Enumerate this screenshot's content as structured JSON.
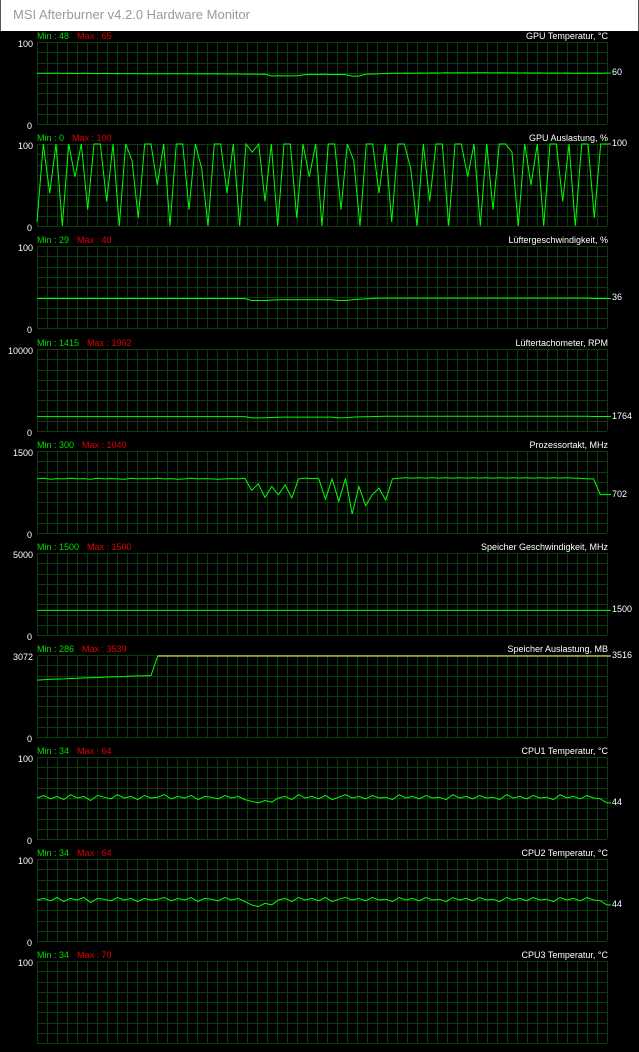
{
  "window": {
    "title": "MSI Afterburner v4.2.0 Hardware Monitor"
  },
  "colors": {
    "grid": "#0b3d0b",
    "trace": "#00ff00",
    "trace_alt": "#ffff66",
    "min_text": "#00dd00",
    "max_text": "#e00000"
  },
  "panels": [
    {
      "title": "GPU Temperatur, °C",
      "min_label": "Min : 48",
      "max_label": "Max : 65",
      "y_max": "100",
      "y_min": "0",
      "current": "60",
      "scale_max": 100,
      "line_color": "#00ff00",
      "series": [
        62,
        62,
        61.8,
        61.9,
        61.7,
        61.8,
        61.6,
        61.8,
        61.6,
        61.5,
        61.7,
        61.5,
        61.6,
        61.4,
        61.5,
        61.3,
        61.5,
        61.4,
        61.3,
        61.4,
        61.2,
        61.3,
        61.2,
        61.3,
        61.1,
        61.2,
        61.1,
        61.2,
        61.0,
        61.1,
        61.0,
        60.8,
        60.9,
        60.7,
        60.8,
        58.5,
        58.8,
        58.7,
        58.6,
        59.0,
        60.3,
        60.5,
        60.5,
        60.6,
        60.3,
        60.5,
        60.2,
        58.2,
        58.5,
        60.6,
        61.0,
        61.3,
        61.5,
        61.8,
        62,
        62.1,
        62.0,
        62.2,
        62.1,
        62.3,
        62.2,
        62.4,
        62.3,
        62.4,
        62.3,
        62.5,
        62.4,
        62.5,
        62.3,
        62.4,
        62.3,
        62.4,
        62.2,
        62.3,
        62.2,
        62.3,
        62.1,
        62.2,
        62.1,
        62.2,
        62.0,
        62.1,
        62.0,
        62.1,
        62.0,
        62.1
      ]
    },
    {
      "title": "GPU Auslastung, %",
      "min_label": "Min : 0",
      "max_label": "Max : 100",
      "y_max": "100",
      "y_min": "0",
      "current": "100",
      "scale_max": 100,
      "line_color": "#00ff00",
      "series": [
        5,
        100,
        40,
        100,
        0,
        100,
        60,
        100,
        20,
        100,
        100,
        30,
        100,
        0,
        100,
        80,
        10,
        100,
        100,
        50,
        100,
        0,
        100,
        100,
        20,
        100,
        70,
        0,
        100,
        100,
        40,
        100,
        0,
        100,
        90,
        100,
        30,
        100,
        0,
        100,
        100,
        10,
        100,
        60,
        100,
        0,
        100,
        100,
        20,
        100,
        80,
        0,
        100,
        100,
        40,
        100,
        5,
        100,
        100,
        70,
        0,
        100,
        30,
        100,
        100,
        0,
        100,
        100,
        60,
        100,
        0,
        100,
        20,
        100,
        100,
        90,
        0,
        100,
        50,
        100,
        0,
        100,
        100,
        30,
        100,
        0,
        100,
        100,
        10,
        100,
        100
      ]
    },
    {
      "title": "Lüftergeschwindigkeit, %",
      "min_label": "Min : 29",
      "max_label": "Max : 40",
      "y_max": "100",
      "y_min": "0",
      "current": "36",
      "scale_max": 100,
      "line_color": "#00ff00",
      "series": [
        36,
        36,
        36,
        36,
        36,
        36,
        36,
        36,
        36,
        36,
        36,
        36,
        36,
        36,
        36,
        36,
        36,
        36,
        36,
        36,
        36,
        36,
        36,
        36,
        36,
        36,
        36,
        36,
        36,
        36,
        36,
        36,
        33.5,
        33.5,
        33.5,
        34,
        34.5,
        34.5,
        34.5,
        34.5,
        34.5,
        34.5,
        34.5,
        34.5,
        34.5,
        33.5,
        33.5,
        34.5,
        35,
        35.5,
        36,
        36.5,
        36.5,
        36.5,
        36.5,
        36.5,
        36.5,
        36.5,
        36.5,
        36.5,
        36.5,
        36.5,
        36.5,
        36.5,
        36.5,
        36.5,
        36.5,
        36.5,
        36.5,
        36.5,
        36.5,
        36.5,
        36.5,
        36.5,
        36.5,
        36.5,
        36.5,
        36.5,
        36.5,
        36.5,
        36.5,
        36.5,
        36.5,
        36,
        36,
        36
      ]
    },
    {
      "title": "Lüftertachometer, RPM",
      "min_label": "Min : 1415",
      "max_label": "Max : 1962",
      "y_max": "10000",
      "y_min": "0",
      "current": "1764",
      "scale_max": 10000,
      "line_color": "#00ff00",
      "series": [
        1760,
        1760,
        1760,
        1760,
        1760,
        1760,
        1760,
        1760,
        1760,
        1760,
        1760,
        1760,
        1760,
        1760,
        1760,
        1760,
        1760,
        1760,
        1760,
        1760,
        1760,
        1760,
        1760,
        1760,
        1760,
        1760,
        1760,
        1760,
        1760,
        1760,
        1760,
        1760,
        1600,
        1600,
        1620,
        1650,
        1680,
        1700,
        1700,
        1700,
        1700,
        1700,
        1700,
        1700,
        1700,
        1600,
        1620,
        1700,
        1720,
        1740,
        1760,
        1780,
        1790,
        1790,
        1790,
        1790,
        1790,
        1790,
        1790,
        1790,
        1790,
        1790,
        1790,
        1790,
        1790,
        1790,
        1790,
        1790,
        1790,
        1790,
        1790,
        1790,
        1790,
        1790,
        1790,
        1790,
        1790,
        1790,
        1790,
        1790,
        1790,
        1790,
        1790,
        1770,
        1764,
        1764
      ]
    },
    {
      "title": "Prozessortakt, MHz",
      "min_label": "Min : 300",
      "max_label": "Max : 1040",
      "y_max": "1500",
      "y_min": "0",
      "current": "702",
      "scale_max": 1500,
      "line_color": "#00ff00",
      "series": [
        990,
        1000,
        985,
        995,
        990,
        1000,
        990,
        995,
        985,
        1000,
        990,
        995,
        990,
        985,
        1000,
        990,
        995,
        990,
        1000,
        990,
        995,
        985,
        990,
        1000,
        990,
        995,
        990,
        985,
        990,
        995,
        990,
        1000,
        780,
        900,
        650,
        850,
        700,
        880,
        640,
        990,
        1005,
        995,
        1000,
        620,
        990,
        580,
        1000,
        350,
        850,
        500,
        700,
        820,
        600,
        990,
        1000,
        1010,
        1005,
        1010,
        1005,
        1010,
        1005,
        1010,
        1005,
        1010,
        1005,
        1010,
        1005,
        1010,
        1005,
        1010,
        1005,
        1010,
        1005,
        1010,
        1005,
        1010,
        1005,
        1010,
        1005,
        1010,
        1005,
        1000,
        990,
        990,
        702,
        702
      ]
    },
    {
      "title": "Speicher Geschwindigkeit, MHz",
      "min_label": "Min : 1500",
      "max_label": "Max : 1500",
      "y_max": "5000",
      "y_min": "0",
      "current": "1500",
      "scale_max": 5000,
      "line_color": "#00ff00",
      "series": [
        1500,
        1500,
        1500,
        1500,
        1500,
        1500,
        1500,
        1500,
        1500,
        1500,
        1500,
        1500,
        1500,
        1500,
        1500,
        1500,
        1500,
        1500,
        1500,
        1500,
        1500,
        1500,
        1500,
        1500,
        1500,
        1500,
        1500,
        1500,
        1500,
        1500,
        1500,
        1500,
        1500,
        1500,
        1500,
        1500,
        1500,
        1500,
        1500,
        1500,
        1500,
        1500,
        1500,
        1500,
        1500,
        1500,
        1500,
        1500,
        1500,
        1500,
        1500,
        1500,
        1500,
        1500,
        1500,
        1500,
        1500,
        1500,
        1500,
        1500,
        1500,
        1500,
        1500,
        1500,
        1500,
        1500,
        1500,
        1500,
        1500,
        1500,
        1500,
        1500,
        1500,
        1500,
        1500,
        1500,
        1500,
        1500,
        1500,
        1500,
        1500,
        1500,
        1500,
        1500,
        1500,
        1500
      ]
    },
    {
      "title": "Speicher Auslastung, MB",
      "min_label": "Min : 286",
      "max_label": "Max : 3539",
      "y_max": "3072",
      "y_min": "0",
      "current": "3516",
      "scale_max": 4096,
      "line_color": "#00ff00",
      "overflow_color": "#ffff66",
      "overflow_threshold": 3072,
      "series": [
        2840,
        2860,
        2880,
        2890,
        2900,
        2920,
        2930,
        2950,
        2960,
        2970,
        2990,
        3000,
        3010,
        3020,
        3040,
        3050,
        3060,
        3070,
        3516,
        3516,
        3516,
        3516,
        3516,
        3516,
        3516,
        3516,
        3516,
        3516,
        3516,
        3516,
        3516,
        3516,
        3516,
        3516,
        3516,
        3516,
        3516,
        3516,
        3516,
        3516,
        3516,
        3516,
        3516,
        3516,
        3516,
        3516,
        3516,
        3516,
        3516,
        3516,
        3516,
        3516,
        3516,
        3516,
        3516,
        3516,
        3516,
        3516,
        3516,
        3516,
        3516,
        3516,
        3516,
        3516,
        3516,
        3516,
        3516,
        3516,
        3516,
        3516,
        3516,
        3516,
        3516,
        3516,
        3516,
        3516,
        3516,
        3516,
        3516,
        3516,
        3516,
        3516,
        3516,
        3516,
        3516,
        3516
      ]
    },
    {
      "title": "CPU1 Temperatur, °C",
      "min_label": "Min : 34",
      "max_label": "Max : 64",
      "y_max": "100",
      "y_min": "0",
      "current": "44",
      "scale_max": 100,
      "line_color": "#00ff00",
      "series": [
        50,
        53,
        49,
        52,
        48,
        54,
        50,
        52,
        47,
        53,
        51,
        49,
        54,
        50,
        52,
        48,
        53,
        50,
        51,
        54,
        49,
        52,
        50,
        53,
        48,
        52,
        51,
        49,
        53,
        50,
        52,
        48,
        46,
        44,
        47,
        45,
        50,
        52,
        48,
        54,
        50,
        52,
        49,
        53,
        48,
        51,
        54,
        50,
        52,
        49,
        53,
        50,
        51,
        48,
        54,
        50,
        52,
        49,
        53,
        50,
        51,
        48,
        54,
        50,
        52,
        49,
        53,
        50,
        51,
        48,
        54,
        50,
        52,
        49,
        53,
        50,
        51,
        48,
        54,
        50,
        52,
        49,
        53,
        50,
        49,
        44
      ]
    },
    {
      "title": "CPU2 Temperatur, °C",
      "min_label": "Min : 34",
      "max_label": "Max : 64",
      "y_max": "100",
      "y_min": "0",
      "current": "44",
      "scale_max": 100,
      "line_color": "#00ff00",
      "series": [
        50,
        52,
        49,
        53,
        48,
        52,
        50,
        53,
        47,
        52,
        51,
        49,
        53,
        50,
        52,
        48,
        52,
        50,
        51,
        53,
        49,
        52,
        50,
        53,
        48,
        52,
        51,
        49,
        53,
        50,
        52,
        48,
        44,
        42,
        46,
        44,
        50,
        52,
        48,
        53,
        50,
        52,
        49,
        53,
        48,
        51,
        53,
        50,
        52,
        49,
        53,
        50,
        51,
        48,
        53,
        50,
        52,
        49,
        53,
        50,
        51,
        48,
        53,
        50,
        52,
        49,
        53,
        50,
        51,
        48,
        53,
        50,
        52,
        49,
        53,
        50,
        51,
        48,
        53,
        50,
        52,
        49,
        53,
        50,
        49,
        44
      ]
    },
    {
      "title": "CPU3 Temperatur, °C",
      "min_label": "Min : 34",
      "max_label": "Max : 70",
      "y_max": "100",
      "y_min": "",
      "current": "",
      "scale_max": 100,
      "line_color": "#00ff00",
      "series": []
    }
  ]
}
